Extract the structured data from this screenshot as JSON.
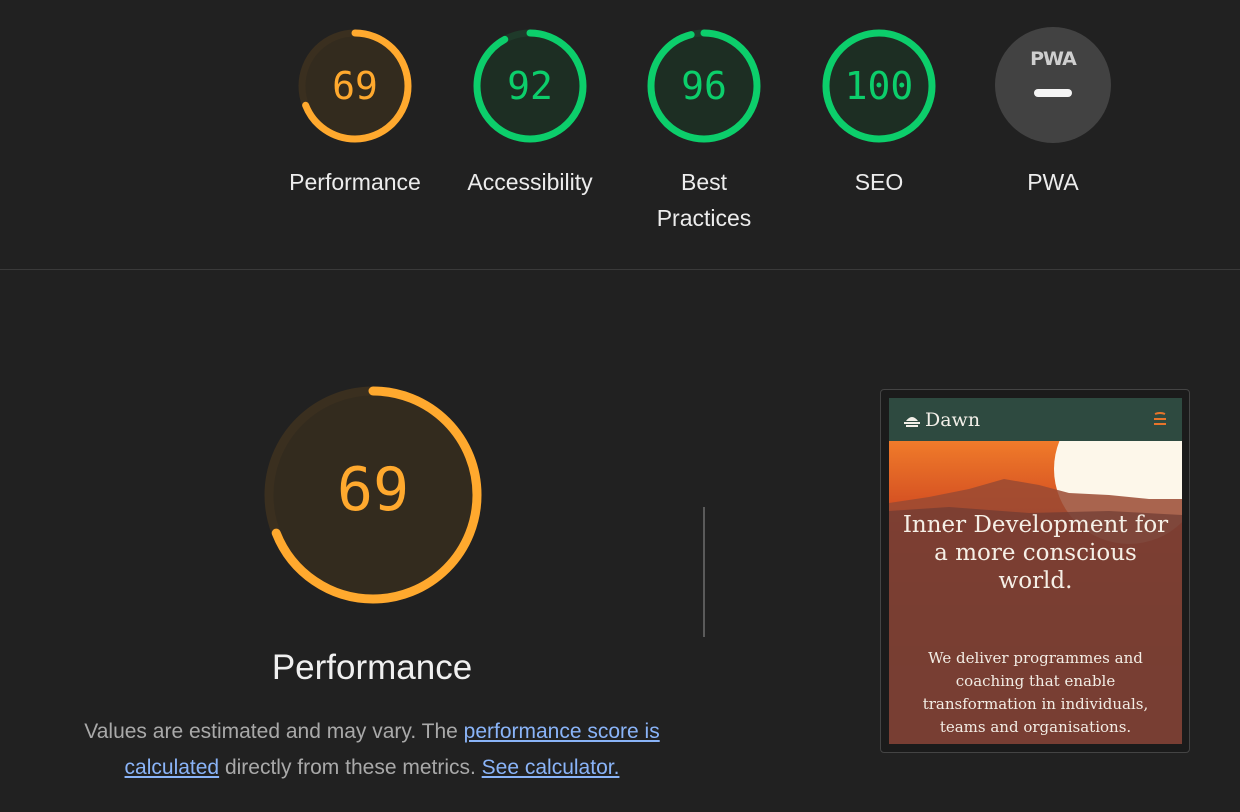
{
  "categories": [
    {
      "id": "performance",
      "score": "69",
      "label": "Performance",
      "value": 69,
      "color": "#ffa92e",
      "track": "#3a2f1f",
      "fill": "#332b1e"
    },
    {
      "id": "accessibility",
      "score": "92",
      "label": "Accessibility",
      "value": 92,
      "color": "#0cce6b",
      "track": "#1f3a2a",
      "fill": "#1d2e23"
    },
    {
      "id": "best-practices",
      "score": "96",
      "label": "Best Practices",
      "value": 96,
      "color": "#0cce6b",
      "track": "#1f3a2a",
      "fill": "#1d2e23"
    },
    {
      "id": "seo",
      "score": "100",
      "label": "SEO",
      "value": 100,
      "color": "#0cce6b",
      "track": "#1f3a2a",
      "fill": "#1d2e23"
    }
  ],
  "pwa": {
    "label": "PWA",
    "badge_text": "PWA",
    "icon": "pwa-icon"
  },
  "main": {
    "score": "69",
    "value": 69,
    "title": "Performance",
    "desc_text_1": "Values are estimated and may vary. The ",
    "desc_link_1": "performance score is calculated",
    "desc_text_2": " directly from these metrics. ",
    "desc_link_2": "See calculator."
  },
  "preview": {
    "brand": "Dawn",
    "logo_icon": "sun-logo-icon",
    "menu_icon": "menu-icon",
    "hero_title": "Inner Development for a more conscious world.",
    "hero_subtitle": "We deliver programmes and coaching that enable transformation in individuals, teams and organisations.",
    "colors": {
      "header": "#2e4a40",
      "accent": "#e8742a"
    }
  }
}
